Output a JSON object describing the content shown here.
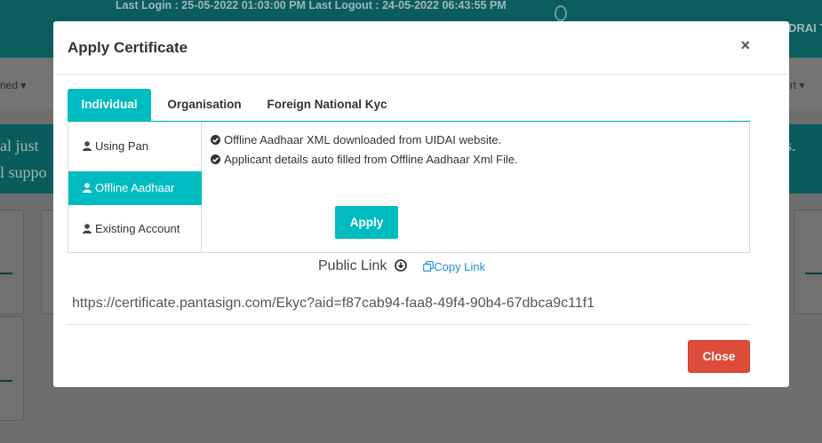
{
  "background": {
    "last_login_line": "Last Login : 25-05-2022 01:03:00 PM    Last Logout :    24-05-2022 06:43:55 PM",
    "user_partial": "DRAI TRIV",
    "nav_left": "ned",
    "nav_right": "upport",
    "banner_line1": "al  just",
    "banner_line2": "l  suppo",
    "banner_right": "utes."
  },
  "modal": {
    "title": "Apply Certificate",
    "close_symbol": "×",
    "tabs": [
      {
        "label": "Individual",
        "active": true
      },
      {
        "label": "Organisation",
        "active": false
      },
      {
        "label": "Foreign National Kyc",
        "active": false
      }
    ],
    "side_items": [
      {
        "label": "Using Pan",
        "active": false
      },
      {
        "label": "Offline Aadhaar",
        "active": true
      },
      {
        "label": "Existing Account",
        "active": false
      }
    ],
    "info_lines": [
      "Offline Aadhaar XML downloaded from UIDAI website.",
      "Applicant details auto filled from Offline Aadhaar Xml File."
    ],
    "apply_label": "Apply",
    "public_link_label": "Public Link",
    "copy_link_label": "Copy Link",
    "url": "https://certificate.pantasign.com/Ekyc?aid=f87cab94-faa8-49f4-90b4-67dbca9c11f1",
    "close_label": "Close"
  },
  "colors": {
    "accent": "#00bcc0",
    "danger": "#dd4b39",
    "link": "#1e90d6"
  }
}
